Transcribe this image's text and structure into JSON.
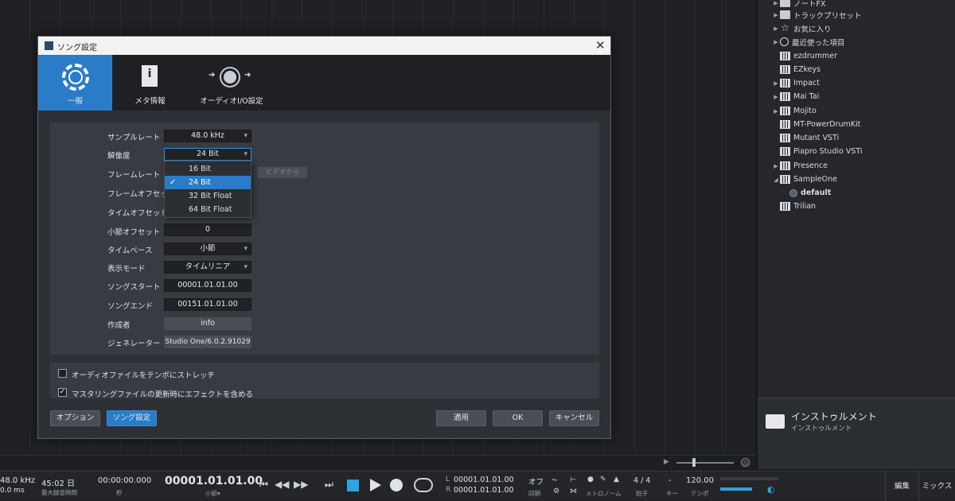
{
  "dialog": {
    "title": "ソング設定",
    "close": "✕",
    "tabs": [
      {
        "label": "一般",
        "active": true
      },
      {
        "label": "メタ情報",
        "active": false
      },
      {
        "label": "オーディオI/O設定",
        "active": false
      }
    ],
    "rows": [
      {
        "label": "サンプルレート",
        "value": "48.0 kHz"
      },
      {
        "label": "解像度",
        "value": "24 Bit"
      },
      {
        "label": "フレームレート",
        "value": ""
      },
      {
        "label": "フレームオフセット",
        "value": ""
      },
      {
        "label": "タイムオフセット",
        "value": ""
      },
      {
        "label": "小節オフセット",
        "value": "0"
      },
      {
        "label": "タイムベース",
        "value": "小節"
      },
      {
        "label": "表示モード",
        "value": "タイムリニア"
      },
      {
        "label": "ソングスタート",
        "value": "00001.01.01.00"
      },
      {
        "label": "ソングエンド",
        "value": "00151.01.01.00"
      },
      {
        "label": "作成者",
        "value": "info"
      },
      {
        "label": "ジェネレーター",
        "value": "Studio One/6.0.2.91029"
      }
    ],
    "video_button": "ビデオから",
    "resolution_dropdown": {
      "options": [
        "16 Bit",
        "24 Bit",
        "32 Bit Float",
        "64 Bit Float"
      ],
      "selected": "24 Bit",
      "check": "✓"
    },
    "checkboxes": [
      {
        "label": "オーディオファイルをテンポにストレッチ",
        "checked": false,
        "mark": ""
      },
      {
        "label": "マスタリングファイルの更新時にエフェクトを含める",
        "checked": true,
        "mark": "✓"
      }
    ],
    "buttons": {
      "options": "オプション",
      "song_settings": "ソング設定",
      "apply": "適用",
      "ok": "OK",
      "cancel": "キャンセル"
    }
  },
  "browser": {
    "items": [
      {
        "label": "ノートFX",
        "icon": "folder-icon",
        "arrow": "▶"
      },
      {
        "label": "トラックプリセット",
        "icon": "folder-icon",
        "arrow": "▶"
      },
      {
        "label": "お気に入り",
        "icon": "star-icon",
        "arrow": "▶"
      },
      {
        "label": "最近使った項目",
        "icon": "clock-icon",
        "arrow": "▶"
      },
      {
        "label": "ezdrummer",
        "icon": "piano-icon",
        "arrow": ""
      },
      {
        "label": "EZkeys",
        "icon": "piano-icon",
        "arrow": ""
      },
      {
        "label": "Impact",
        "icon": "piano-icon",
        "arrow": "▶"
      },
      {
        "label": "Mai Tai",
        "icon": "piano-icon",
        "arrow": "▶"
      },
      {
        "label": "Mojito",
        "icon": "piano-icon",
        "arrow": "▶"
      },
      {
        "label": "MT-PowerDrumKit",
        "icon": "piano-icon",
        "arrow": ""
      },
      {
        "label": "Mutant VSTi",
        "icon": "piano-icon",
        "arrow": ""
      },
      {
        "label": "Piapro Studio VSTi",
        "icon": "piano-icon",
        "arrow": ""
      },
      {
        "label": "Presence",
        "icon": "piano-icon",
        "arrow": "▶"
      },
      {
        "label": "SampleOne",
        "icon": "piano-icon",
        "arrow": "◢"
      },
      {
        "label": "default",
        "icon": "preset-icon",
        "arrow": ""
      },
      {
        "label": "Trilian",
        "icon": "piano-icon",
        "arrow": ""
      }
    ],
    "footer_title": "インストゥルメント",
    "footer_sub": "インストゥルメント"
  },
  "transport": {
    "sample_rate": "48.0 kHz",
    "latency": "0.0 ms",
    "record_time": "45:02 日",
    "record_time_label": "最大録音時間",
    "seconds_time": "00:00:00.000",
    "seconds_label": "秒",
    "position": "00001.01.01.00",
    "position_label": "小節▾",
    "loop_l_tag": "L",
    "loop_r_tag": "R",
    "loop_l": "00001.01.01.00",
    "loop_r": "00001.01.01.00",
    "sync_value": "オフ",
    "sync_label": "同期",
    "metronome_label": "メトロノーム",
    "time_sig": "4 / 4",
    "time_sig_label": "拍子",
    "key_value": "-",
    "key_label": "キー",
    "tempo": "120.00",
    "tempo_label": "テンポ",
    "edit": "編集",
    "mix": "ミックス"
  }
}
